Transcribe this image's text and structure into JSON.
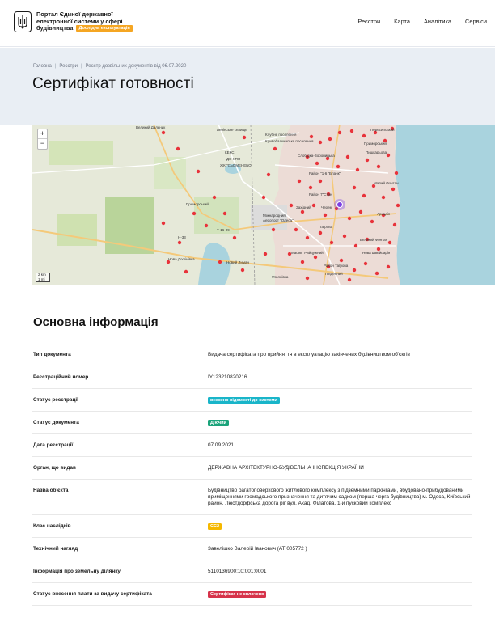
{
  "header": {
    "portal_title": "Портал Єдиної державної електронної системи у сфері будівництва",
    "beta_label": "Дослідна експлуатація",
    "nav": [
      "Реєстри",
      "Карта",
      "Аналітика",
      "Сервіси"
    ]
  },
  "breadcrumb": [
    "Головна",
    "Реєстри",
    "Реєстр дозвільних документів від 06.07.2020"
  ],
  "page_title": "Сертифікат готовності",
  "map": {
    "zoom_in": "+",
    "zoom_out": "−",
    "scale_km": "2 km",
    "scale_mi": "1 mi",
    "labels": [
      "Великий Дальник",
      "Ленінське селище",
      "Клубне поселення",
      "Кривобалкинське поселення",
      "КЕКС",
      "ДО УПО",
      "ЖК \"СЬОМЕНЕБО\"",
      "Слобідка-Вороницька",
      "Район \"1-6 \"Бланк\"",
      "Пересипський",
      "Приморський",
      "Пишкарьова",
      "Район 7\"Стан",
      "Малий Фонтан",
      "Аркадія",
      "Т-16-09",
      "Аеропорт \"Одеса\"",
      "Міжнародний",
      "Західний",
      "Черем",
      "Приморський",
      "Великий Фонтан",
      "Н-33",
      "Нова Дофінівка",
      "Масив \"Райдужний\"",
      "Таїрова",
      "Новий Лиман",
      "Нова Швейцарія",
      "Ульянівка",
      "Район Таїрова",
      "Південний"
    ],
    "pin_color": "#e8333b",
    "marker_color": "#7b3fe4"
  },
  "info": {
    "section_title": "Основна інформація",
    "rows": [
      {
        "label": "Тип документа",
        "value": "Видача сертифіката про прийняття в експлуатацію закінчених будівництвом об'єктів"
      },
      {
        "label": "Реєстраційний номер",
        "value": "ІУ123210820216"
      },
      {
        "label": "Статус реєстрації",
        "value": "внесено відомості до системи",
        "badge": "cyan"
      },
      {
        "label": "Статус документа",
        "value": "Діючий",
        "badge": "green"
      },
      {
        "label": "Дата реєстрації",
        "value": "07.09.2021"
      },
      {
        "label": "Орган, що видав",
        "value": "ДЕРЖАВНА АРХІТЕКТУРНО-БУДІВЕЛЬНА ІНСПЕКЦІЯ УКРАЇНИ"
      },
      {
        "label": "Назва об'єкта",
        "value": "Будівництво багатоповерхового житлового комплексу з підземними паркінгами, вбудовано-прибудованими приміщеннями громадського призначення та дитячим садком (перша черга будівництва) м. Одеса, Київський район, Люстдорфська дорога ріг вул. Акад. Філатова. 1-й пусковий комплекс"
      },
      {
        "label": "Клас наслідків",
        "value": "СС2",
        "badge": "yellow"
      },
      {
        "label": "Технічний нагляд",
        "value": "Завелішко Валерій Іванович (АТ 005772 )"
      },
      {
        "label": "Інформація про земельну ділянку",
        "value": "5110136900:10:001:0001"
      },
      {
        "label": "Статус внесення плати за видачу сертифіката",
        "value": "Сертифікат не сплачено",
        "badge": "red"
      }
    ]
  }
}
